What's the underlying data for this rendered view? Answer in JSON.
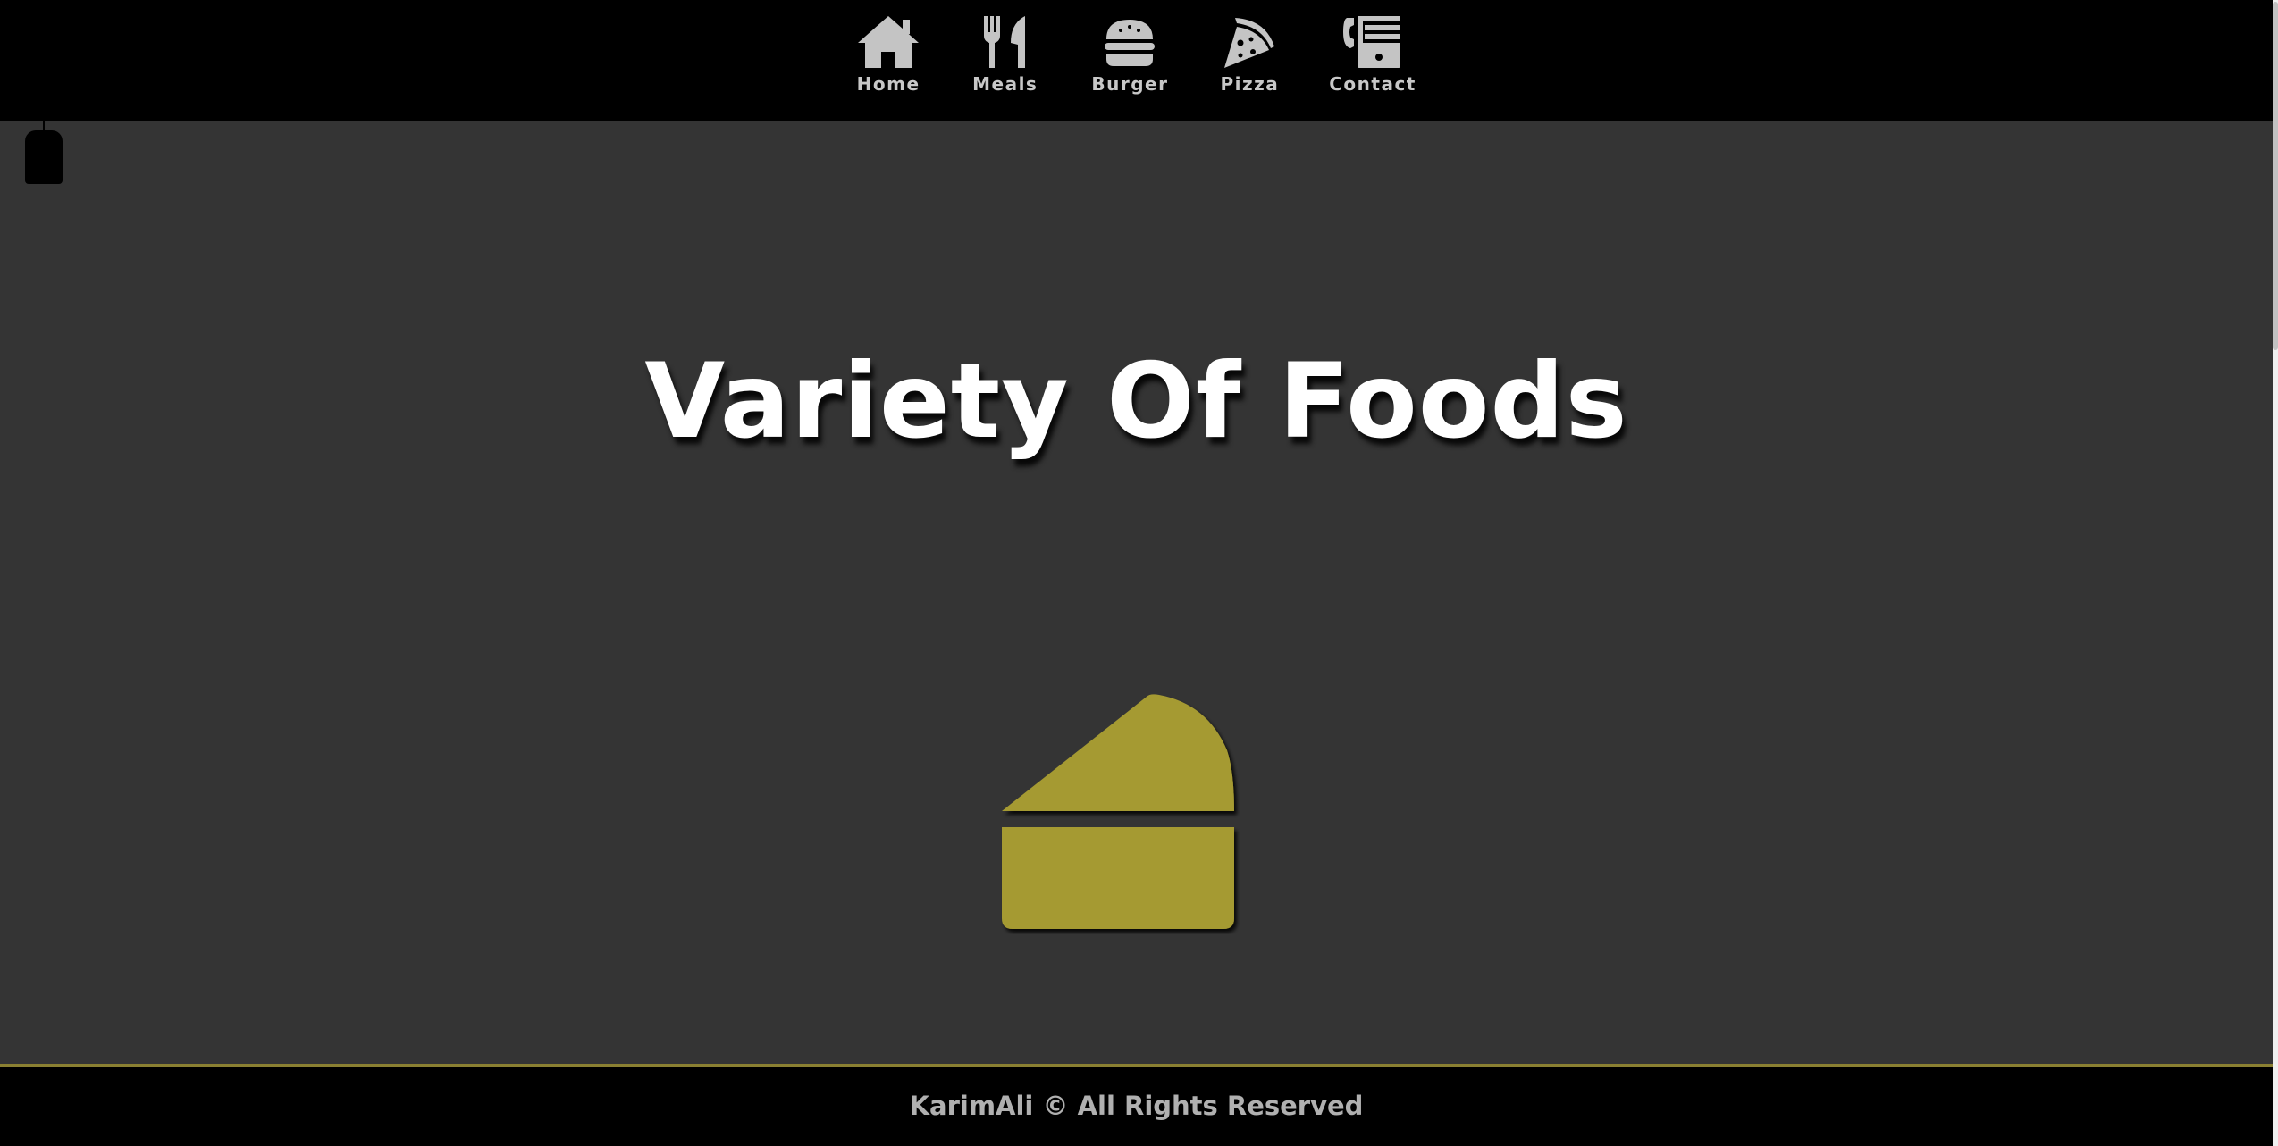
{
  "nav": {
    "items": [
      {
        "label": "Home",
        "icon": "home-icon"
      },
      {
        "label": "Meals",
        "icon": "utensils-icon"
      },
      {
        "label": "Burger",
        "icon": "burger-icon"
      },
      {
        "label": "Pizza",
        "icon": "pizza-icon"
      },
      {
        "label": "Contact",
        "icon": "phone-fax-icon"
      }
    ]
  },
  "hero": {
    "title": "Variety Of Foods",
    "image_icon": "cake-slice-icon"
  },
  "footer": {
    "text": "KarimAli © All Rights Reserved"
  },
  "colors": {
    "nav_background": "#000000",
    "page_background": "#343434",
    "accent": "#a59a32",
    "nav_text": "#c8c8c8",
    "footer_border": "#8a8032"
  }
}
